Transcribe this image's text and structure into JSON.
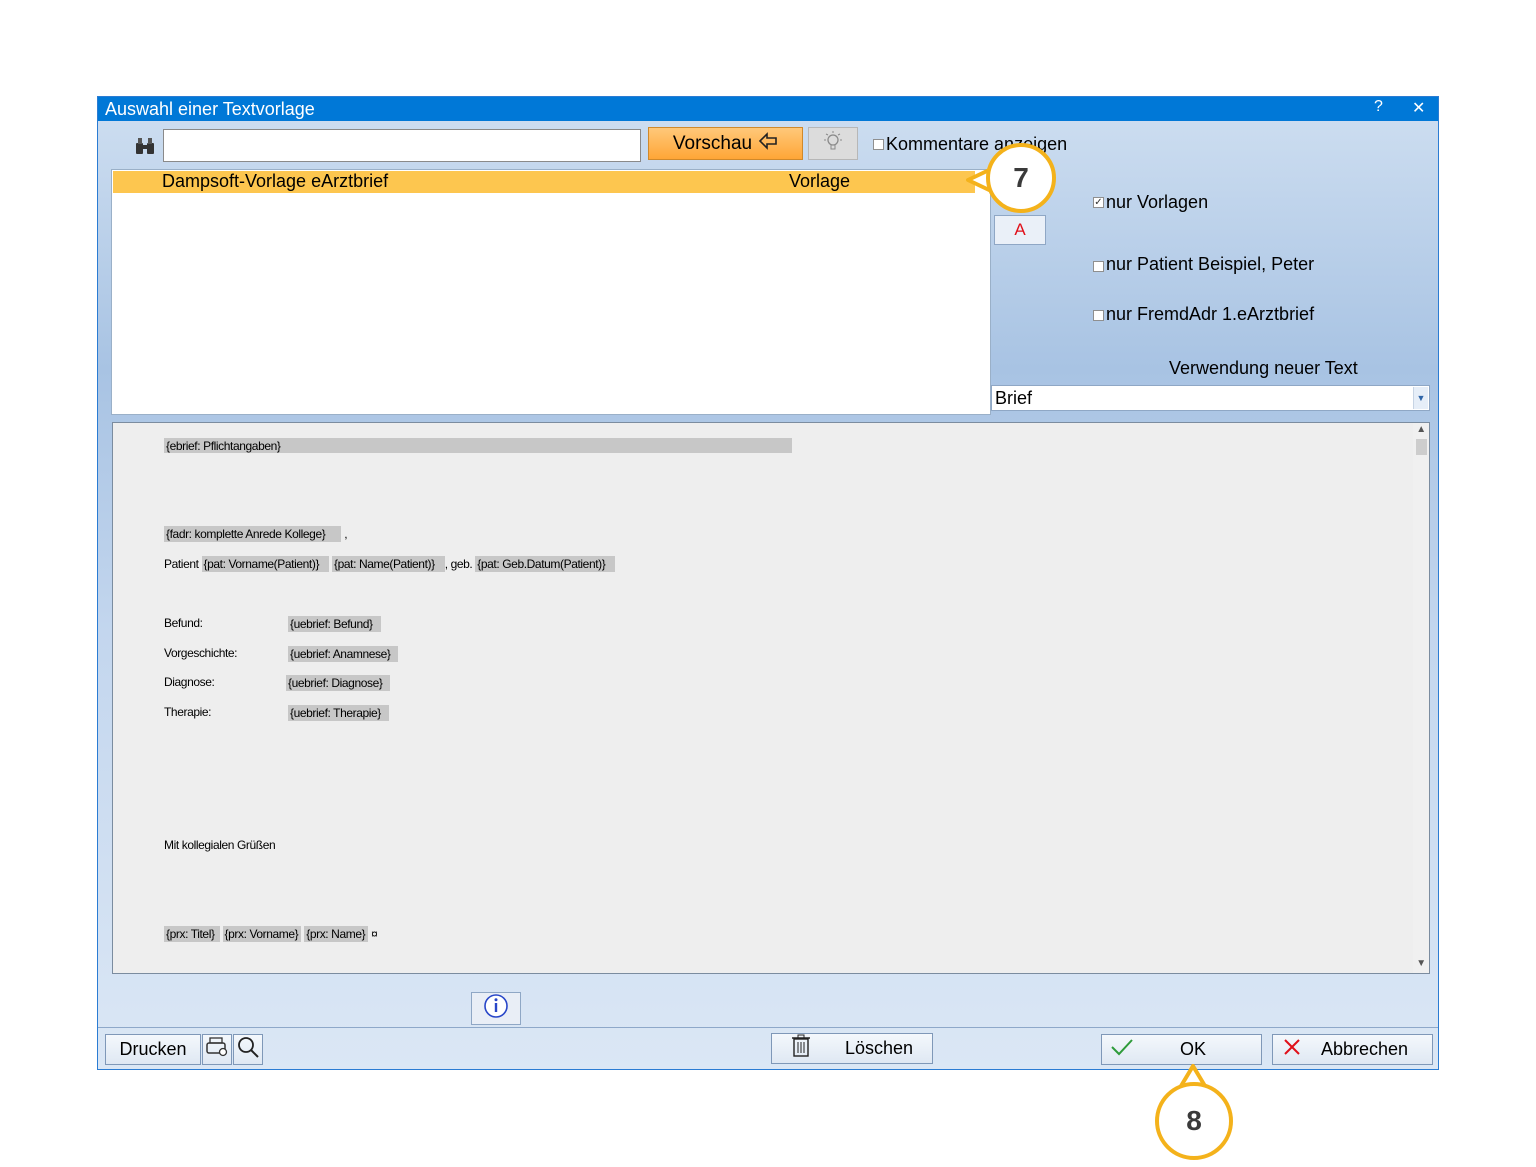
{
  "window": {
    "title": "Auswahl einer Textvorlage",
    "help": "?",
    "close": "✕"
  },
  "toolbar": {
    "search_value": "",
    "preview_label": "Vorschau",
    "comments_label": "Kommentare anzeigen",
    "comments_checked": false
  },
  "list": {
    "rows": [
      {
        "name": "Dampsoft-Vorlage eArztbrief",
        "type": "Vorlage"
      }
    ]
  },
  "side": {
    "a_button": "A",
    "filters": [
      {
        "label": "nur Vorlagen",
        "checked": true
      },
      {
        "label": "nur Patient Beispiel, Peter",
        "checked": false
      },
      {
        "label": "nur FremdAdr 1.eArztbrief",
        "checked": false
      }
    ],
    "usage_label": "Verwendung neuer Text",
    "usage_value": "Brief"
  },
  "preview": {
    "pflicht": "{ebrief: Pflichtangaben}",
    "anrede": "{fadr: komplette Anrede Kollege}",
    "anrede_suffix": ",",
    "patient_label": "Patient",
    "pat_vorname": "{pat: Vorname(Patient)}",
    "pat_name": "{pat: Name(Patient)}",
    "geb_label": ", geb.",
    "pat_geb": "{pat: Geb.Datum(Patient)}",
    "rows": [
      {
        "label": "Befund:",
        "field": "{uebrief: Befund}"
      },
      {
        "label": "Vorgeschichte:",
        "field": "{uebrief: Anamnese}"
      },
      {
        "label": "Diagnose:",
        "field": "{uebrief: Diagnose}"
      },
      {
        "label": "Therapie:",
        "field": "{uebrief: Therapie}"
      }
    ],
    "closing": "Mit kollegialen Grüßen",
    "prx_titel": "{prx: Titel}",
    "prx_vorname": "{prx: Vorname}",
    "prx_name": "{prx: Name}",
    "para_mark": "¤"
  },
  "footer": {
    "print_label": "Drucken",
    "delete_label": "Löschen",
    "ok_label": "OK",
    "cancel_label": "Abbrechen"
  },
  "callouts": {
    "first": "7",
    "second": "8"
  },
  "colors": {
    "accent": "#0078d7",
    "highlight": "#fdc64f",
    "callout": "#f4b21b"
  }
}
